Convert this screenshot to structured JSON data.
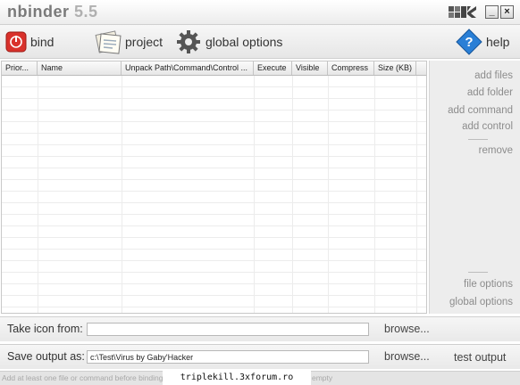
{
  "app": {
    "name": "nbinder",
    "version": "5.5"
  },
  "window": {
    "minimize_label": "_",
    "close_label": "×"
  },
  "toolbar": {
    "bind": "bind",
    "project": "project",
    "global_options": "global options",
    "help": "help"
  },
  "table": {
    "columns": [
      "Prior...",
      "Name",
      "Unpack Path\\Command\\Control ...",
      "Execute",
      "Visible",
      "Compress",
      "Size (KB)"
    ],
    "rows": []
  },
  "side_panel": {
    "add_files": "add files",
    "add_folder": "add folder",
    "add_command": "add command",
    "add_control": "add control",
    "remove": "remove",
    "file_options": "file options",
    "global_options": "global options"
  },
  "icon_row": {
    "label": "Take icon from:",
    "value": "",
    "browse": "browse..."
  },
  "save_row": {
    "label": "Save output as:",
    "value": "c:\\Test\\Virus by Gaby'Hacker",
    "browse": "browse...",
    "test_output": "test output"
  },
  "status": {
    "message_start": "Add at least one file or command before binding",
    "message_end": "empty"
  },
  "watermark": "triplekill.3xforum.ro",
  "colors": {
    "accent_red": "#d9312b",
    "help_blue": "#2a7fd6",
    "link_gray": "#8c8c8c"
  }
}
